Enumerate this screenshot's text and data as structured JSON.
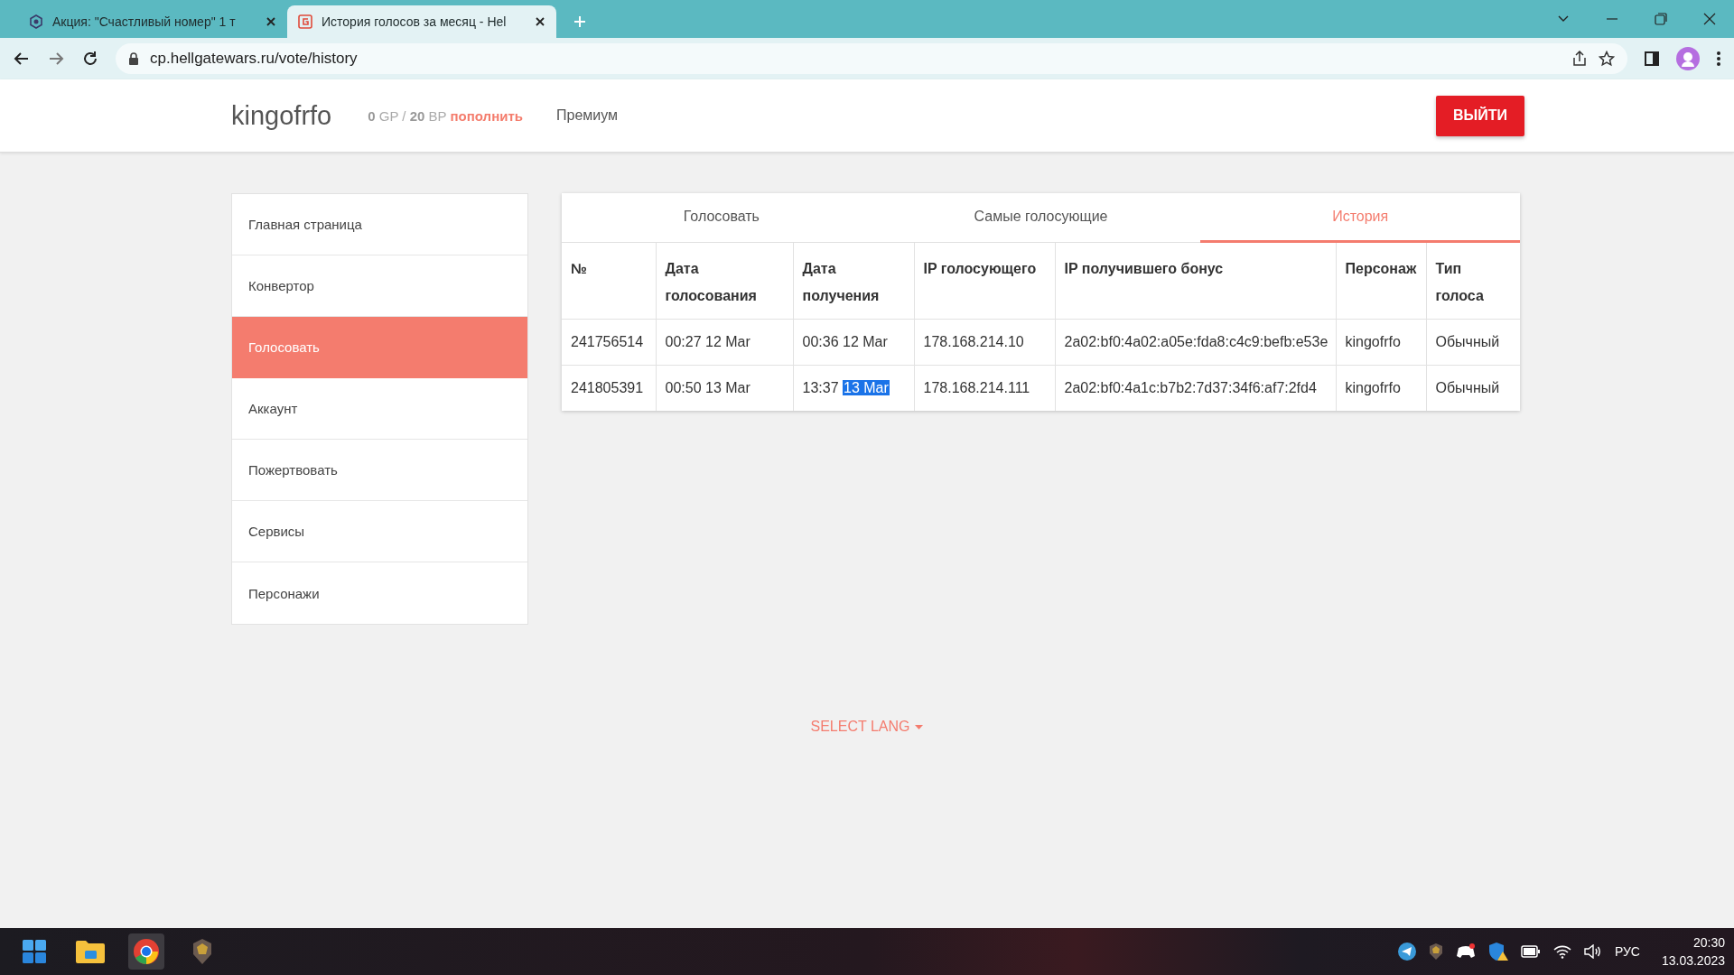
{
  "browser": {
    "tabs": [
      {
        "title": "Акция: \"Счастливый номер\" 1 т",
        "selected": false
      },
      {
        "title": "История голосов за месяц - Hel",
        "selected": true
      }
    ],
    "url": "cp.hellgatewars.ru/vote/history"
  },
  "header": {
    "username": "kingofrfo",
    "gp_amount": "0",
    "gp_unit": "GP",
    "separator": "/",
    "bp_amount": "20",
    "bp_unit": "BP",
    "topup_link": "пополнить",
    "premium_link": "Премиум",
    "logout_button": "ВЫЙТИ"
  },
  "sidebar": {
    "items": [
      {
        "label": "Главная страница",
        "selected": false
      },
      {
        "label": "Конвертор",
        "selected": false
      },
      {
        "label": "Голосовать",
        "selected": true
      },
      {
        "label": "Аккаунт",
        "selected": false
      },
      {
        "label": "Пожертвовать",
        "selected": false
      },
      {
        "label": "Сервисы",
        "selected": false
      },
      {
        "label": "Персонажи",
        "selected": false
      }
    ]
  },
  "vote_card": {
    "tabs": [
      {
        "label": "Голосовать",
        "selected": false
      },
      {
        "label": "Самые голосующие",
        "selected": false
      },
      {
        "label": "История",
        "selected": true
      }
    ],
    "table": {
      "columns": [
        "№",
        "Дата голосования",
        "Дата получения",
        "IP голосующего",
        "IP получившего бонус",
        "Персонаж",
        "Тип голоса"
      ],
      "rows": [
        {
          "cells": [
            "241756514",
            "00:27 12 Mar",
            "00:36 12 Mar",
            "178.168.214.10",
            "2a02:bf0:4a02:a05e:fda8:c4c9:befb:e53e",
            "kingofrfo",
            "Обычный"
          ]
        },
        {
          "cells": [
            "241805391",
            "00:50 13 Mar",
            {
              "text": "13:37",
              "selected_text": "13 Mar"
            },
            "178.168.214.111",
            "2a02:bf0:4a1c:b7b2:7d37:34f6:af7:2fd4",
            "kingofrfo",
            "Обычный"
          ]
        }
      ]
    }
  },
  "footer": {
    "language_selector": "SELECT LANG"
  },
  "taskbar": {
    "tray_language": "РУС",
    "time": "20:30",
    "date": "13.03.2023"
  }
}
